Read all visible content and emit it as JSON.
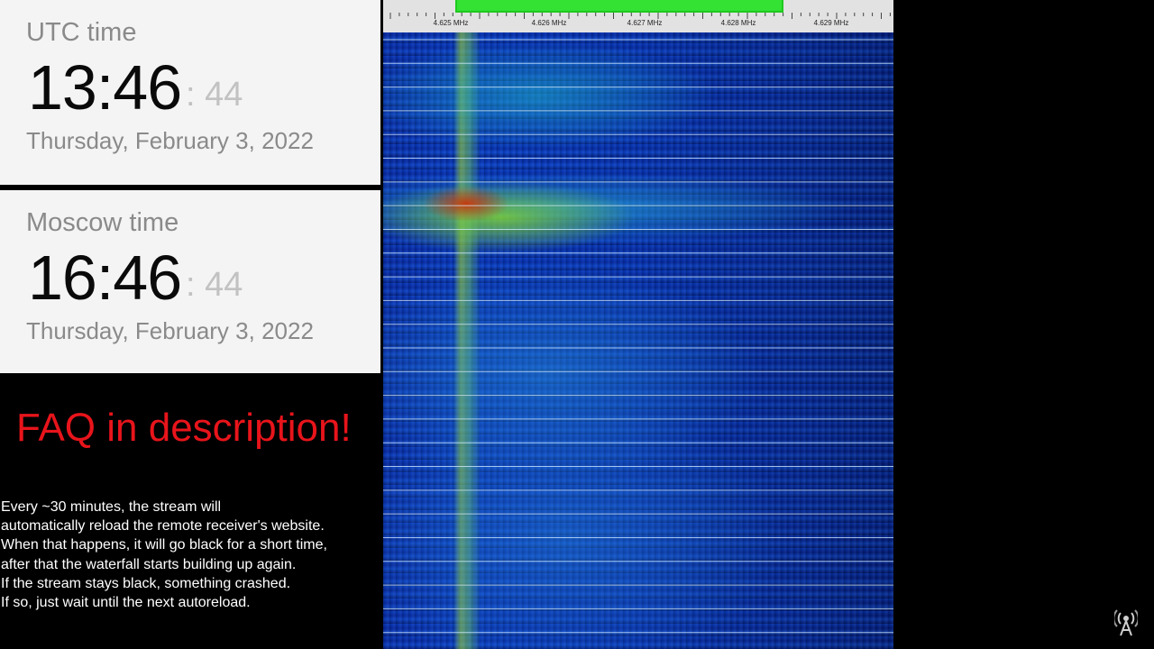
{
  "utc_clock": {
    "label": "UTC time",
    "time": "13:46",
    "seconds": ": 44",
    "date": "Thursday, February 3, 2022"
  },
  "moscow_clock": {
    "label": "Moscow time",
    "time": "16:46",
    "seconds": ": 44",
    "date": "Thursday, February 3, 2022"
  },
  "faq_text": "FAQ in description!",
  "notice_lines": [
    "Every ~30 minutes, the stream will",
    "automatically reload the remote receiver's website.",
    "When that happens, it will go black for a short time,",
    "after that the waterfall starts building up again.",
    "If the stream stays black, something crashed.",
    "If so, just wait until the next autoreload."
  ],
  "waterfall": {
    "frequency_labels": [
      "4.625 MHz",
      "4.626 MHz",
      "4.627 MHz",
      "4.628 MHz",
      "4.629 MHz"
    ],
    "horizontal_line_count": 26,
    "colors": {
      "background": "#0a38c0",
      "signal": "#a8e628",
      "peak": "#d62400",
      "passband": "#33e233",
      "line": "#d8f0ff"
    }
  },
  "colors": {
    "faq": "#e8141b",
    "clock_text": "#0a0a0a",
    "clock_muted": "#8a8a8a",
    "panel_bg": "#f4f4f4"
  },
  "icons": {
    "broadcast": "antenna-icon"
  }
}
